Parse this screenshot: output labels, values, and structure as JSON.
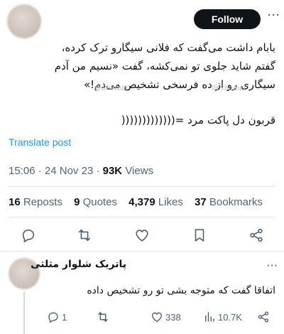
{
  "tweet": {
    "follow_label": "Follow",
    "more_label": "···",
    "lines": [
      "بابام داشت می‌گفت که فلانی سیگارو ترک کرده،",
      "گفتم شاید جلوی تو نمی‌کشه، گفت «نسیم من آدم",
      "سیگاری رو از ده فرسخی تشخیص می‌دم!»",
      "قربون دل پاکت مرد =((((((((((((("
    ],
    "watermarks": [
      "@ShatoLi",
      "@ShatoLi"
    ],
    "translate_label": "Translate post",
    "time": "15:06",
    "date": "24 Nov 23",
    "views_count": "93K",
    "views_label": "Views",
    "stats": {
      "reposts_count": "16",
      "reposts_label": "Reposts",
      "quotes_count": "9",
      "quotes_label": "Quotes",
      "likes_count": "4,379",
      "likes_label": "Likes",
      "bookmarks_count": "37",
      "bookmarks_label": "Bookmarks"
    },
    "actions": [
      "reply-icon",
      "repost-icon",
      "like-icon",
      "bookmark-icon",
      "share-icon"
    ]
  },
  "reply": {
    "author_name": "پاتریک شلوار مثلثی",
    "text": "اتفاقا گفت که متوجه بشی تو رو تشخیص داده",
    "more_label": "···",
    "reply_count": "1",
    "like_count": "338",
    "views_count": "10.7K"
  },
  "colors": {
    "text": "#0f1419",
    "secondary": "#536471",
    "link": "#1d9bf0",
    "divider": "#e1e6ea",
    "button_bg": "#0f1419"
  }
}
